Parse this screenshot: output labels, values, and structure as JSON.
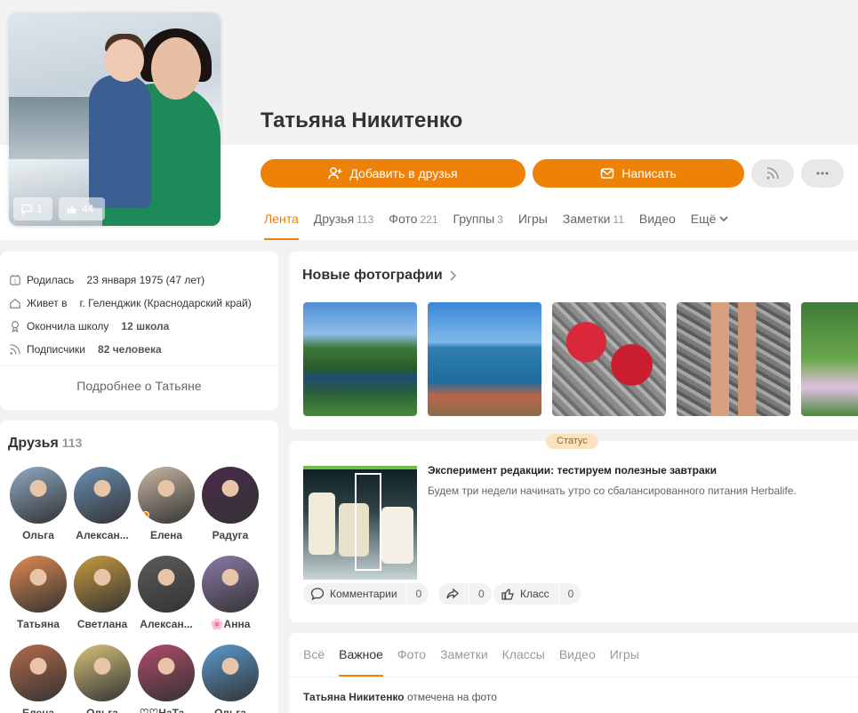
{
  "profile": {
    "name": "Татьяна Никитенко",
    "avatar_badges": {
      "comments": "1",
      "likes": "44"
    }
  },
  "actions": {
    "add_friend": "Добавить в друзья",
    "message": "Написать"
  },
  "tabs": [
    {
      "label": "Лента",
      "count": ""
    },
    {
      "label": "Друзья",
      "count": "113"
    },
    {
      "label": "Фото",
      "count": "221"
    },
    {
      "label": "Группы",
      "count": "3"
    },
    {
      "label": "Игры",
      "count": ""
    },
    {
      "label": "Заметки",
      "count": "11"
    },
    {
      "label": "Видео",
      "count": ""
    },
    {
      "label": "Ещё",
      "count": ""
    }
  ],
  "info": {
    "born_label": "Родилась",
    "born_value": "23 января 1975 (47 лет)",
    "lives_label": "Живет в",
    "lives_value": "г. Геленджик (Краснодарский край)",
    "school_label": "Окончила школу",
    "school_value": "12 школа",
    "subs_label": "Подписчики",
    "subs_value": "82 человека",
    "more": "Подробнее о Татьяне"
  },
  "friends": {
    "title": "Друзья",
    "count": "113",
    "items": [
      {
        "name": "Ольга",
        "color": "#8fa9c4"
      },
      {
        "name": "Алексан...",
        "color": "#6a8fb5"
      },
      {
        "name": "Елена",
        "color": "#c9b8a4"
      },
      {
        "name": "Радуга",
        "color": "#4a2a4d"
      },
      {
        "name": "Татьяна",
        "color": "#e38a4f"
      },
      {
        "name": "Светлана",
        "color": "#c99c3e"
      },
      {
        "name": "Алексан...",
        "color": "#5c5c5c"
      },
      {
        "name": "🌸Анна",
        "color": "#8c7aa8"
      },
      {
        "name": "Елена",
        "color": "#b56a4a"
      },
      {
        "name": "Ольга",
        "color": "#d7c37a"
      },
      {
        "name": "♡♡НаТа...",
        "color": "#b34a6a"
      },
      {
        "name": "Ольга",
        "color": "#5a9ad1"
      }
    ]
  },
  "photos": {
    "title": "Новые фотографии"
  },
  "status": {
    "badge": "Статус",
    "headline": "Эксперимент редакции: тестируем полезные завтраки",
    "text": "Будем три недели начинать утро со сбалансированного питания Herbalife.",
    "comments_label": "Комментарии",
    "comments_count": "0",
    "shares_count": "0",
    "likes_label": "Класс",
    "likes_count": "0"
  },
  "feed": {
    "tabs": [
      "Всё",
      "Важное",
      "Фото",
      "Заметки",
      "Классы",
      "Видео",
      "Игры"
    ],
    "item_author": "Татьяна Никитенко",
    "item_text": "отмечена на фото"
  },
  "colors": {
    "accent": "#ee8208",
    "status_badge_bg": "#fbe4bd"
  }
}
